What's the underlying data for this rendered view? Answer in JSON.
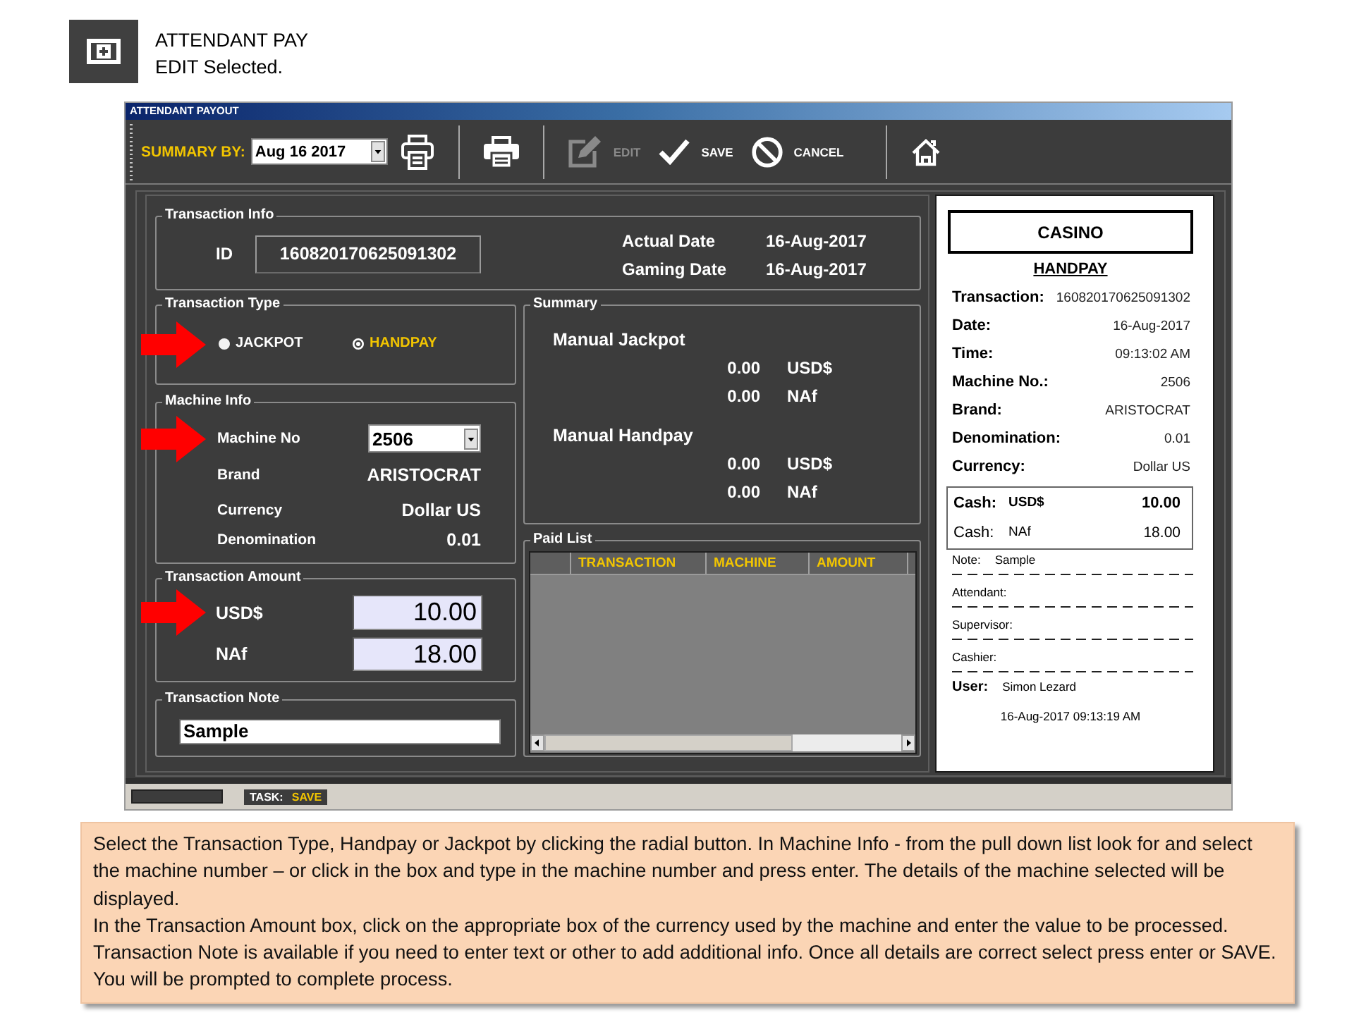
{
  "header": {
    "title": "ATTENDANT PAY",
    "subtitle": "EDIT Selected."
  },
  "window": {
    "title": "ATTENDANT PAYOUT"
  },
  "toolbar": {
    "summary_label": "SUMMARY BY:",
    "summary_date": "Aug 16 2017",
    "items": [
      {
        "kind": "report"
      },
      {
        "kind": "separator"
      },
      {
        "kind": "print"
      },
      {
        "kind": "separator"
      },
      {
        "kind": "edit",
        "label": "EDIT",
        "disabled": true
      },
      {
        "kind": "save",
        "label": "SAVE",
        "disabled": false
      },
      {
        "kind": "cancel",
        "label": "CANCEL",
        "disabled": false
      },
      {
        "kind": "separator"
      },
      {
        "kind": "home"
      }
    ]
  },
  "transaction_info": {
    "title": "Transaction Info",
    "id_label": "ID",
    "id_value": "160820170625091302",
    "dates": [
      {
        "label": "Actual Date",
        "value": "16-Aug-2017"
      },
      {
        "label": "Gaming Date",
        "value": "16-Aug-2017"
      }
    ]
  },
  "transaction_type": {
    "title": "Transaction Type",
    "options": [
      {
        "label": "JACKPOT",
        "selected": false,
        "arrow": true
      },
      {
        "label": "HANDPAY",
        "selected": true,
        "arrow": false
      }
    ]
  },
  "machine_info": {
    "title": "Machine Info",
    "machine": {
      "label": "Machine No",
      "value": "2506",
      "arrow": true
    },
    "details": [
      {
        "label": "Brand",
        "value": "ARISTOCRAT"
      },
      {
        "label": "Currency",
        "value": "Dollar US"
      },
      {
        "label": "Denomination",
        "value": "0.01"
      }
    ]
  },
  "transaction_amount": {
    "title": "Transaction Amount",
    "rows": [
      {
        "label": "USD$",
        "value": "10.00",
        "arrow": true
      },
      {
        "label": "NAf",
        "value": "18.00",
        "arrow": false
      }
    ]
  },
  "transaction_note": {
    "title": "Transaction Note",
    "value": "Sample"
  },
  "summary": {
    "title": "Summary",
    "groups": [
      {
        "label": "Manual Jackpot",
        "rows": [
          {
            "amount": "0.00",
            "currency": "USD$"
          },
          {
            "amount": "0.00",
            "currency": "NAf"
          }
        ]
      },
      {
        "label": "Manual Handpay",
        "rows": [
          {
            "amount": "0.00",
            "currency": "USD$"
          },
          {
            "amount": "0.00",
            "currency": "NAf"
          }
        ]
      }
    ]
  },
  "paid_list": {
    "title": "Paid List",
    "columns": [
      "TRANSACTION",
      "MACHINE",
      "AMOUNT"
    ]
  },
  "receipt": {
    "header": "CASINO",
    "type": "HANDPAY",
    "rows": [
      {
        "label": "Transaction:",
        "value": "160820170625091302"
      },
      {
        "label": "Date:",
        "value": "16-Aug-2017"
      },
      {
        "label": "Time:",
        "value": "09:13:02 AM"
      },
      {
        "label": "Machine No.:",
        "value": "2506"
      },
      {
        "label": "Brand:",
        "value": "ARISTOCRAT"
      },
      {
        "label": "Denomination:",
        "value": "0.01"
      },
      {
        "label": "Currency:",
        "value": "Dollar US"
      }
    ],
    "cash": [
      {
        "label": "Cash:",
        "currency": "USD$",
        "amount": "10.00",
        "emphasized": true
      },
      {
        "label": "Cash:",
        "currency": "NAf",
        "amount": "18.00",
        "emphasized": false
      }
    ],
    "lines": [
      {
        "label": "Note:",
        "value": "Sample"
      },
      {
        "label": "Attendant:"
      },
      {
        "label": "Supervisor:"
      },
      {
        "label": "Cashier:"
      }
    ],
    "user": {
      "label": "User:",
      "value": "Simon Lezard"
    },
    "printed": "16-Aug-2017 09:13:19 AM"
  },
  "status_bar": {
    "task_label": "TASK:",
    "task": "SAVE"
  },
  "instructions": [
    "Select the Transaction Type, Handpay or Jackpot by clicking the radial button. In Machine Info - from the pull down list look for and select the machine number – or click in the box and type in the machine number and press enter. The details of the machine selected will be displayed.",
    "In the Transaction Amount box, click on the appropriate box of the currency used by the machine and enter the value to be processed. Transaction Note is available if you need to enter text or other to add additional info. Once all details are correct select press enter or SAVE. You will be prompted to complete process."
  ]
}
